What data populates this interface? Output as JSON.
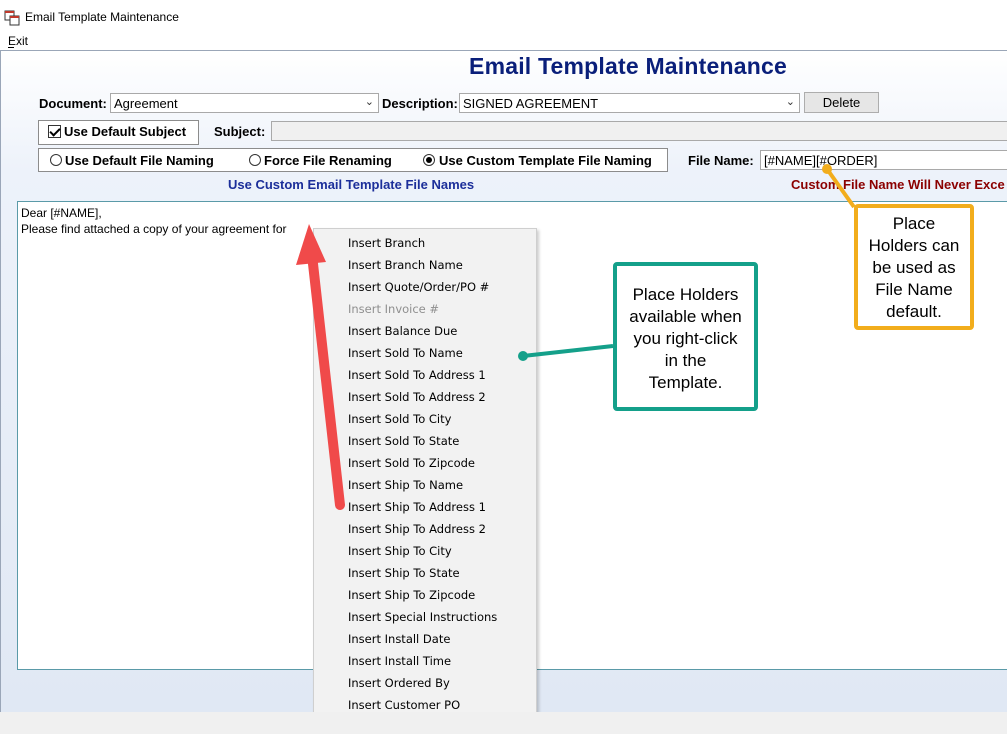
{
  "window": {
    "title": "Email Template Maintenance",
    "menu_exit": "Exit"
  },
  "header": {
    "title": "Email Template Maintenance"
  },
  "form": {
    "document_label": "Document:",
    "document_value": "Agreement",
    "description_label": "Description:",
    "description_value": "SIGNED AGREEMENT",
    "delete_label": "Delete",
    "use_default_subject_label": "Use Default Subject",
    "subject_label": "Subject:",
    "subject_value": "",
    "naming_options": [
      {
        "label": "Use Default File Naming",
        "selected": false
      },
      {
        "label": "Force File Renaming",
        "selected": false
      },
      {
        "label": "Use Custom Template File Naming",
        "selected": true
      }
    ],
    "file_name_label": "File Name:",
    "file_name_value": "[#NAME][#ORDER]",
    "custom_hint": "Use Custom Email Template File Names",
    "warning_hint": "Custom File Name Will Never Exce"
  },
  "editor": {
    "lines": [
      "Dear [#NAME],",
      "Please find attached a copy of your agreement for"
    ]
  },
  "context_menu": {
    "items": [
      {
        "label": "Insert Branch",
        "enabled": true
      },
      {
        "label": "Insert Branch Name",
        "enabled": true
      },
      {
        "label": "Insert Quote/Order/PO #",
        "enabled": true
      },
      {
        "label": "Insert Invoice #",
        "enabled": false
      },
      {
        "label": "Insert Balance Due",
        "enabled": true
      },
      {
        "label": "Insert Sold To Name",
        "enabled": true
      },
      {
        "label": "Insert Sold To Address 1",
        "enabled": true
      },
      {
        "label": "Insert Sold To Address 2",
        "enabled": true
      },
      {
        "label": "Insert Sold To City",
        "enabled": true
      },
      {
        "label": "Insert Sold To State",
        "enabled": true
      },
      {
        "label": "Insert Sold To Zipcode",
        "enabled": true
      },
      {
        "label": "Insert Ship To Name",
        "enabled": true
      },
      {
        "label": "Insert Ship To Address 1",
        "enabled": true
      },
      {
        "label": "Insert Ship To Address 2",
        "enabled": true
      },
      {
        "label": "Insert Ship To City",
        "enabled": true
      },
      {
        "label": "Insert Ship To State",
        "enabled": true
      },
      {
        "label": "Insert Ship To Zipcode",
        "enabled": true
      },
      {
        "label": "Insert Special Instructions",
        "enabled": true
      },
      {
        "label": "Insert Install Date",
        "enabled": true
      },
      {
        "label": "Insert Install Time",
        "enabled": true
      },
      {
        "label": "Insert Ordered By",
        "enabled": true
      },
      {
        "label": "Insert Customer PO",
        "enabled": true
      }
    ]
  },
  "annotations": {
    "green_callout": [
      "Place Holders",
      "available when",
      "you right-click",
      "in the",
      "Template."
    ],
    "orange_callout": [
      "Place",
      "Holders can",
      "be used as",
      "File Name",
      "default."
    ],
    "colors": {
      "green": "#14a08a",
      "orange": "#f2ad1c",
      "red_arrow": "#f04a4a"
    }
  },
  "icons": {
    "app": "app-window-icon",
    "dropdown": "chevron-down-icon",
    "checkbox": "checkbox-checked-icon"
  }
}
